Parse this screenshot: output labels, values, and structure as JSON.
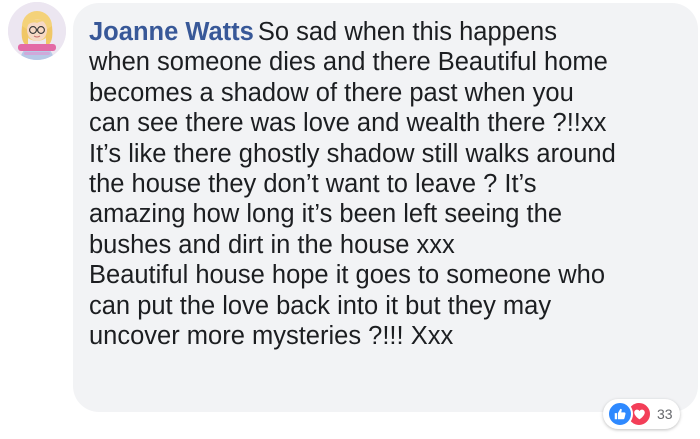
{
  "comment": {
    "author": "Joanne Watts",
    "lines": [
      "So sad when this happens",
      "when someone dies and there Beautiful home",
      "becomes a shadow of there past when you",
      "can see there was love and wealth there ?!!xx",
      "It’s like there ghostly shadow still walks around",
      "the house they don’t want to leave ? It’s",
      "amazing how long it’s been left seeing the",
      "bushes and dirt in the house xxx",
      "Beautiful house hope it goes to someone who",
      "can put the love back into it but they may",
      "uncover more mysteries ?!!! Xxx"
    ]
  },
  "reactions": {
    "count": "33",
    "icons": [
      "like-icon",
      "love-icon"
    ]
  },
  "colors": {
    "author": "#385898",
    "bubble": "#f2f3f5",
    "like": "#2e89ff",
    "love": "#f33e58",
    "text": "#1c1e21"
  }
}
